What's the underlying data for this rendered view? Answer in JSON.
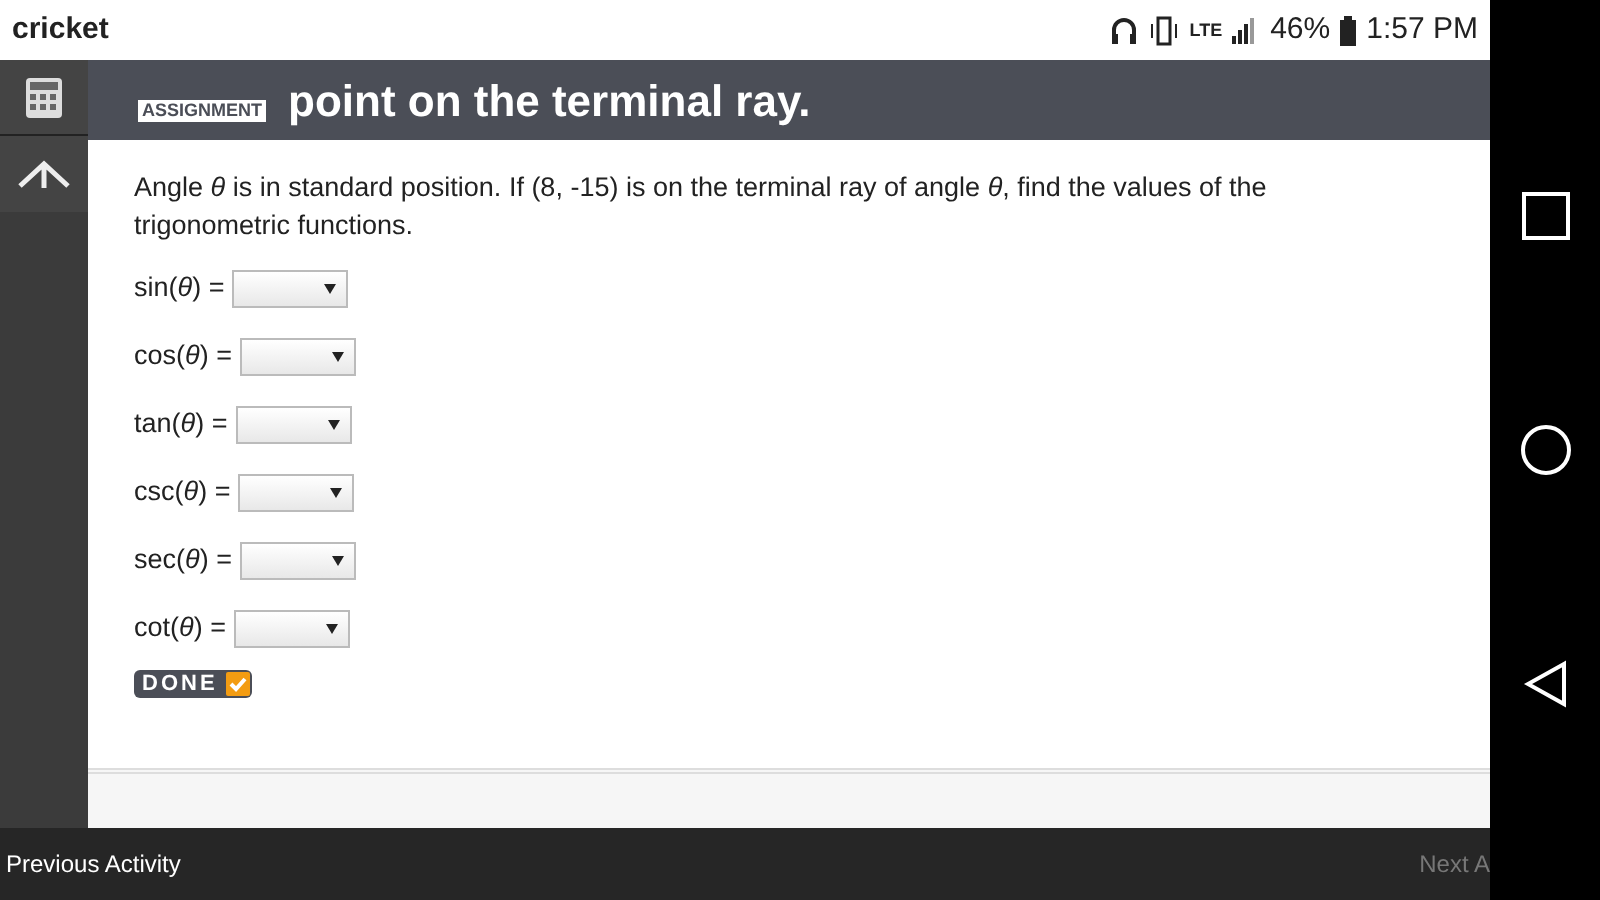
{
  "status_bar": {
    "carrier": "cricket",
    "network": "LTE",
    "battery": "46%",
    "time": "1:57 PM"
  },
  "header": {
    "badge": "ASSIGNMENT",
    "title": "point on the terminal ray."
  },
  "question": "Angle *θ* is in standard position. If (8, -15) is on the terminal ray of angle *θ*, find the values of the trigonometric functions.",
  "answers": [
    {
      "label": "sin(*θ*) ="
    },
    {
      "label": "cos(*θ*) ="
    },
    {
      "label": "tan(*θ*) ="
    },
    {
      "label": "csc(*θ*) ="
    },
    {
      "label": "sec(*θ*) ="
    },
    {
      "label": "cot(*θ*) ="
    }
  ],
  "done_button": {
    "label": "DONE"
  },
  "footer": {
    "previous": "Previous Activity",
    "next": "Next A"
  }
}
